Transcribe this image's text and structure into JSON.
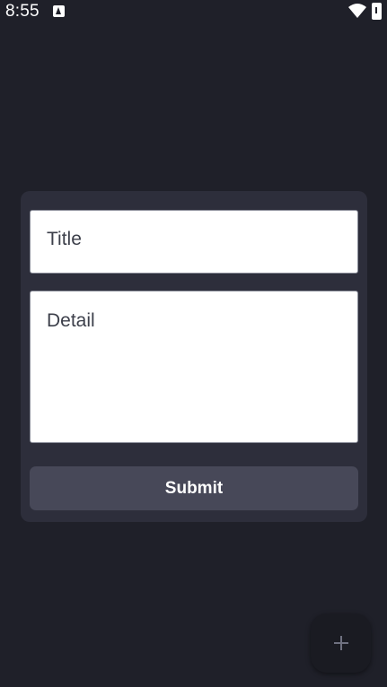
{
  "status_bar": {
    "time": "8:55",
    "icons": [
      "notification-a-icon",
      "wifi-icon",
      "battery-icon"
    ]
  },
  "form": {
    "title_placeholder": "Title",
    "detail_placeholder": "Detail",
    "submit_label": "Submit"
  },
  "fab": {
    "icon": "plus-icon"
  },
  "colors": {
    "background": "#1f2029",
    "card": "#2d2e3b",
    "button": "#474858",
    "field": "#ffffff"
  }
}
